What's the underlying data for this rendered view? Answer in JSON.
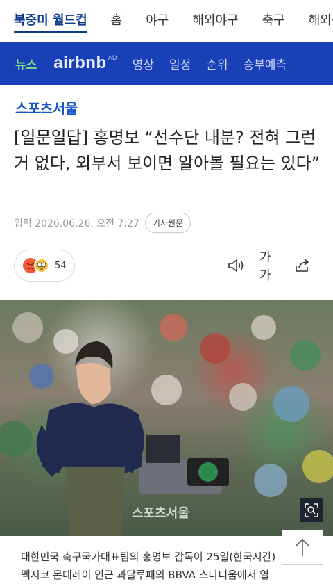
{
  "top_nav": {
    "items": [
      {
        "label": "북중미 월드컵",
        "active": true
      },
      {
        "label": "홈",
        "active": false
      },
      {
        "label": "야구",
        "active": false
      },
      {
        "label": "해외야구",
        "active": false
      },
      {
        "label": "축구",
        "active": false
      },
      {
        "label": "해외축",
        "active": false
      }
    ]
  },
  "sub_nav": {
    "items": [
      "뉴스",
      "영상",
      "일정",
      "순위",
      "승부예측"
    ],
    "sponsor": {
      "logo": "airbnb",
      "ad": "AD"
    }
  },
  "article": {
    "source": "스포츠서울",
    "title": "[일문일답] 홍명보 “선수단 내분? 전혀 그런 거 없다, 외부서 보이면 알아볼 필요는 있다”",
    "date": "입력 2026.06.26. 오전 7:27",
    "original_button": "기사원문",
    "reaction_count": "54",
    "font_size_label": "가가",
    "photo_watermark": "스포츠서울",
    "body_lines": [
      "대한민국 축구국가대표팀의 홍명보 감독이 25일(한국시간)",
      "멕시코 몬테레이 인근 과달루페의 BBVA 스타디움에서 열"
    ]
  },
  "colors": {
    "brand_blue": "#0b3a8f",
    "subnav_bg": "#1a40b8",
    "active_green": "#7fe07f"
  },
  "icons": [
    "volume-icon",
    "share-icon",
    "zoom-icon",
    "arrow-up-icon"
  ]
}
